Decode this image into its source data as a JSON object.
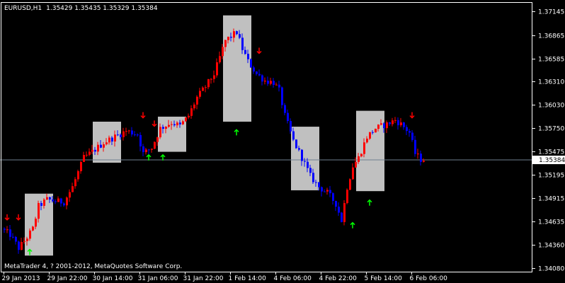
{
  "header": {
    "symbol_timeframe": "EURUSD,H1",
    "ohlc": "1.35429 1.35435 1.35329 1.35384"
  },
  "footer": {
    "copyright": "MetaTrader 4, ? 2001-2012, MetaQuotes Software Corp."
  },
  "colors": {
    "background": "#000000",
    "foreground": "#ffffff",
    "bull": "#ff0000",
    "bear": "#0000ff",
    "box": "#c0c0c0",
    "up_arrow": "#00ff00",
    "down_arrow": "#ff0000",
    "bid_line": "#708090"
  },
  "chart_data": {
    "type": "candlestick",
    "symbol": "EURUSD",
    "timeframe": "H1",
    "ylim": [
      1.3408,
      1.3714
    ],
    "current_price": 1.35384,
    "current_price_label": "1.35384",
    "yticks": [
      {
        "value": 1.37145,
        "label": "1.37145"
      },
      {
        "value": 1.36865,
        "label": "1.36865"
      },
      {
        "value": 1.36585,
        "label": "1.36585"
      },
      {
        "value": 1.3631,
        "label": "1.36310"
      },
      {
        "value": 1.3603,
        "label": "1.36030"
      },
      {
        "value": 1.3575,
        "label": "1.35750"
      },
      {
        "value": 1.35475,
        "label": "1.35475"
      },
      {
        "value": 1.35195,
        "label": "1.35195"
      },
      {
        "value": 1.34915,
        "label": "1.34915"
      },
      {
        "value": 1.34635,
        "label": "1.34635"
      },
      {
        "value": 1.3436,
        "label": "1.34360"
      },
      {
        "value": 1.3408,
        "label": "1.34080"
      }
    ],
    "xticks": [
      {
        "bar": 0,
        "label": "29 Jan 2013"
      },
      {
        "bar": 16,
        "label": "29 Jan 22:00"
      },
      {
        "bar": 32,
        "label": "30 Jan 14:00"
      },
      {
        "bar": 48,
        "label": "31 Jan 06:00"
      },
      {
        "bar": 64,
        "label": "31 Jan 22:00"
      },
      {
        "bar": 80,
        "label": "1 Feb 14:00"
      },
      {
        "bar": 96,
        "label": "4 Feb 06:00"
      },
      {
        "bar": 112,
        "label": "4 Feb 22:00"
      },
      {
        "bar": 128,
        "label": "5 Feb 14:00"
      },
      {
        "bar": 144,
        "label": "6 Feb 06:00"
      }
    ],
    "anchors": [
      [
        0,
        1.3455
      ],
      [
        3,
        1.3448
      ],
      [
        6,
        1.3432
      ],
      [
        9,
        1.3445
      ],
      [
        11,
        1.3455
      ],
      [
        13,
        1.3482
      ],
      [
        16,
        1.349
      ],
      [
        19,
        1.3488
      ],
      [
        22,
        1.3487
      ],
      [
        25,
        1.3505
      ],
      [
        29,
        1.354
      ],
      [
        32,
        1.3547
      ],
      [
        36,
        1.3558
      ],
      [
        40,
        1.3565
      ],
      [
        44,
        1.3572
      ],
      [
        48,
        1.3568
      ],
      [
        50,
        1.3545
      ],
      [
        53,
        1.3552
      ],
      [
        56,
        1.3575
      ],
      [
        60,
        1.3582
      ],
      [
        63,
        1.3578
      ],
      [
        66,
        1.359
      ],
      [
        69,
        1.3612
      ],
      [
        72,
        1.3625
      ],
      [
        75,
        1.364
      ],
      [
        77,
        1.366
      ],
      [
        79,
        1.368
      ],
      [
        81,
        1.3685
      ],
      [
        83,
        1.369
      ],
      [
        85,
        1.367
      ],
      [
        87,
        1.3655
      ],
      [
        90,
        1.364
      ],
      [
        93,
        1.3632
      ],
      [
        96,
        1.363
      ],
      [
        98,
        1.362
      ],
      [
        100,
        1.359
      ],
      [
        103,
        1.356
      ],
      [
        106,
        1.354
      ],
      [
        109,
        1.3518
      ],
      [
        112,
        1.3505
      ],
      [
        115,
        1.3498
      ],
      [
        118,
        1.3485
      ],
      [
        120,
        1.3465
      ],
      [
        122,
        1.3505
      ],
      [
        124,
        1.353
      ],
      [
        126,
        1.354
      ],
      [
        129,
        1.3565
      ],
      [
        132,
        1.3575
      ],
      [
        136,
        1.358
      ],
      [
        139,
        1.3585
      ],
      [
        141,
        1.358
      ],
      [
        144,
        1.357
      ],
      [
        146,
        1.3545
      ],
      [
        148,
        1.3538
      ]
    ],
    "boxes": [
      {
        "from_bar": 8,
        "to_bar": 17,
        "low": 1.3423,
        "high": 1.3497
      },
      {
        "from_bar": 32,
        "to_bar": 41,
        "low": 1.3534,
        "high": 1.3583
      },
      {
        "from_bar": 55,
        "to_bar": 64,
        "low": 1.3547,
        "high": 1.3589
      },
      {
        "from_bar": 78,
        "to_bar": 87,
        "low": 1.3583,
        "high": 1.371
      },
      {
        "from_bar": 102,
        "to_bar": 111,
        "low": 1.3501,
        "high": 1.3577
      },
      {
        "from_bar": 125,
        "to_bar": 134,
        "low": 1.35,
        "high": 1.3596
      }
    ],
    "arrows": [
      {
        "bar": 1,
        "dir": "down",
        "price": 1.3469
      },
      {
        "bar": 5,
        "dir": "down",
        "price": 1.3469
      },
      {
        "bar": 9,
        "dir": "up",
        "price": 1.3427
      },
      {
        "bar": 49,
        "dir": "down",
        "price": 1.3591
      },
      {
        "bar": 51,
        "dir": "up",
        "price": 1.354
      },
      {
        "bar": 53,
        "dir": "down",
        "price": 1.3581
      },
      {
        "bar": 56,
        "dir": "up",
        "price": 1.354
      },
      {
        "bar": 90,
        "dir": "down",
        "price": 1.3668
      },
      {
        "bar": 82,
        "dir": "up",
        "price": 1.357
      },
      {
        "bar": 123,
        "dir": "up",
        "price": 1.3459
      },
      {
        "bar": 129,
        "dir": "up",
        "price": 1.3486
      },
      {
        "bar": 144,
        "dir": "down",
        "price": 1.3591
      }
    ]
  }
}
